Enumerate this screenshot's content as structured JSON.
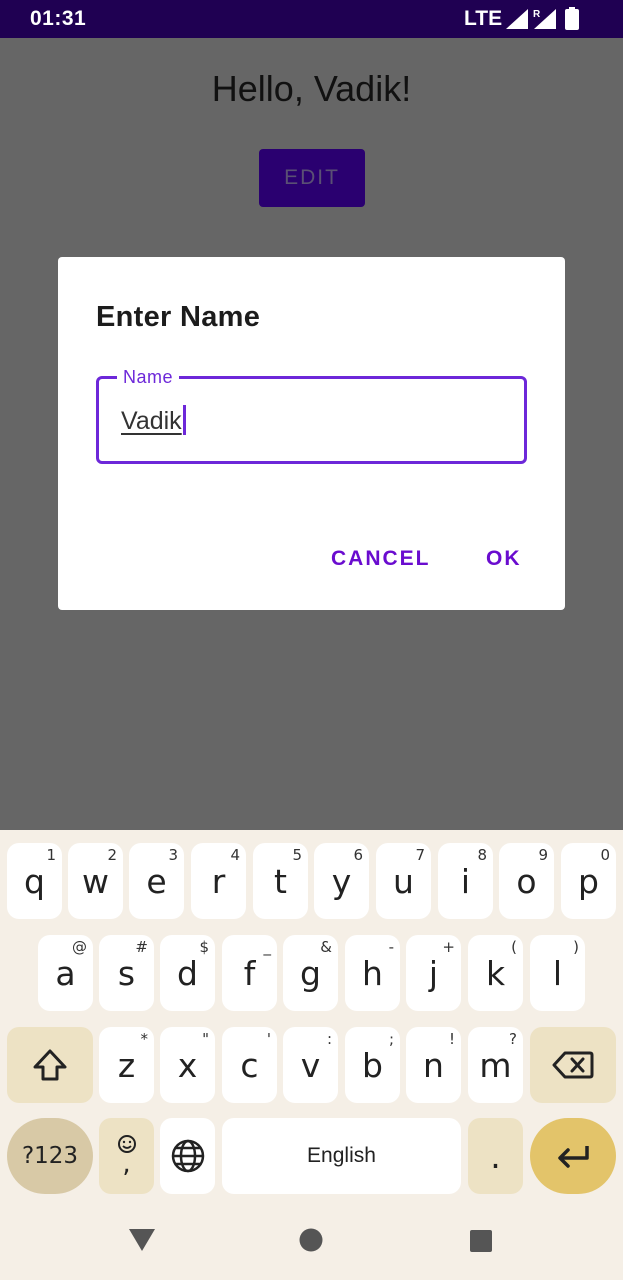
{
  "status_bar": {
    "time": "01:31",
    "network": "LTE",
    "signal_icon": "signal-icon",
    "roaming_icon": "roaming-signal-icon",
    "battery_icon": "battery-icon"
  },
  "app": {
    "greeting": "Hello, Vadik!",
    "edit_label": "EDIT"
  },
  "dialog": {
    "title": "Enter Name",
    "field_label": "Name",
    "field_value": "Vadik",
    "cancel_label": "CANCEL",
    "ok_label": "OK"
  },
  "keyboard": {
    "row1": [
      {
        "k": "q",
        "h": "1"
      },
      {
        "k": "w",
        "h": "2"
      },
      {
        "k": "e",
        "h": "3"
      },
      {
        "k": "r",
        "h": "4"
      },
      {
        "k": "t",
        "h": "5"
      },
      {
        "k": "y",
        "h": "6"
      },
      {
        "k": "u",
        "h": "7"
      },
      {
        "k": "i",
        "h": "8"
      },
      {
        "k": "o",
        "h": "9"
      },
      {
        "k": "p",
        "h": "0"
      }
    ],
    "row2": [
      {
        "k": "a",
        "h": "@"
      },
      {
        "k": "s",
        "h": "#"
      },
      {
        "k": "d",
        "h": "$"
      },
      {
        "k": "f",
        "h": "_"
      },
      {
        "k": "g",
        "h": "&"
      },
      {
        "k": "h",
        "h": "-"
      },
      {
        "k": "j",
        "h": "+"
      },
      {
        "k": "k",
        "h": "("
      },
      {
        "k": "l",
        "h": ")"
      }
    ],
    "row3": [
      {
        "k": "z",
        "h": "*"
      },
      {
        "k": "x",
        "h": "\""
      },
      {
        "k": "c",
        "h": "'"
      },
      {
        "k": "v",
        "h": ":"
      },
      {
        "k": "b",
        "h": ";"
      },
      {
        "k": "n",
        "h": "!"
      },
      {
        "k": "m",
        "h": "?"
      }
    ],
    "symbols_label": "?123",
    "emoji_comma_label": ",",
    "space_label": "English",
    "period_label": ".",
    "shift_icon": "shift-icon",
    "backspace_icon": "backspace-icon",
    "globe_icon": "globe-icon",
    "emoji_icon": "emoji-icon",
    "enter_icon": "enter-icon"
  },
  "nav_bar": {
    "back_icon": "back-icon",
    "home_icon": "home-icon",
    "recents_icon": "recents-icon"
  },
  "colors": {
    "status_bar": "#1f0052",
    "accent": "#6d28d9",
    "dialog_button": "#6a0ccf",
    "scrim": "#666666",
    "keyboard_bg": "#f5efe6",
    "enter_key": "#e3c46a"
  }
}
